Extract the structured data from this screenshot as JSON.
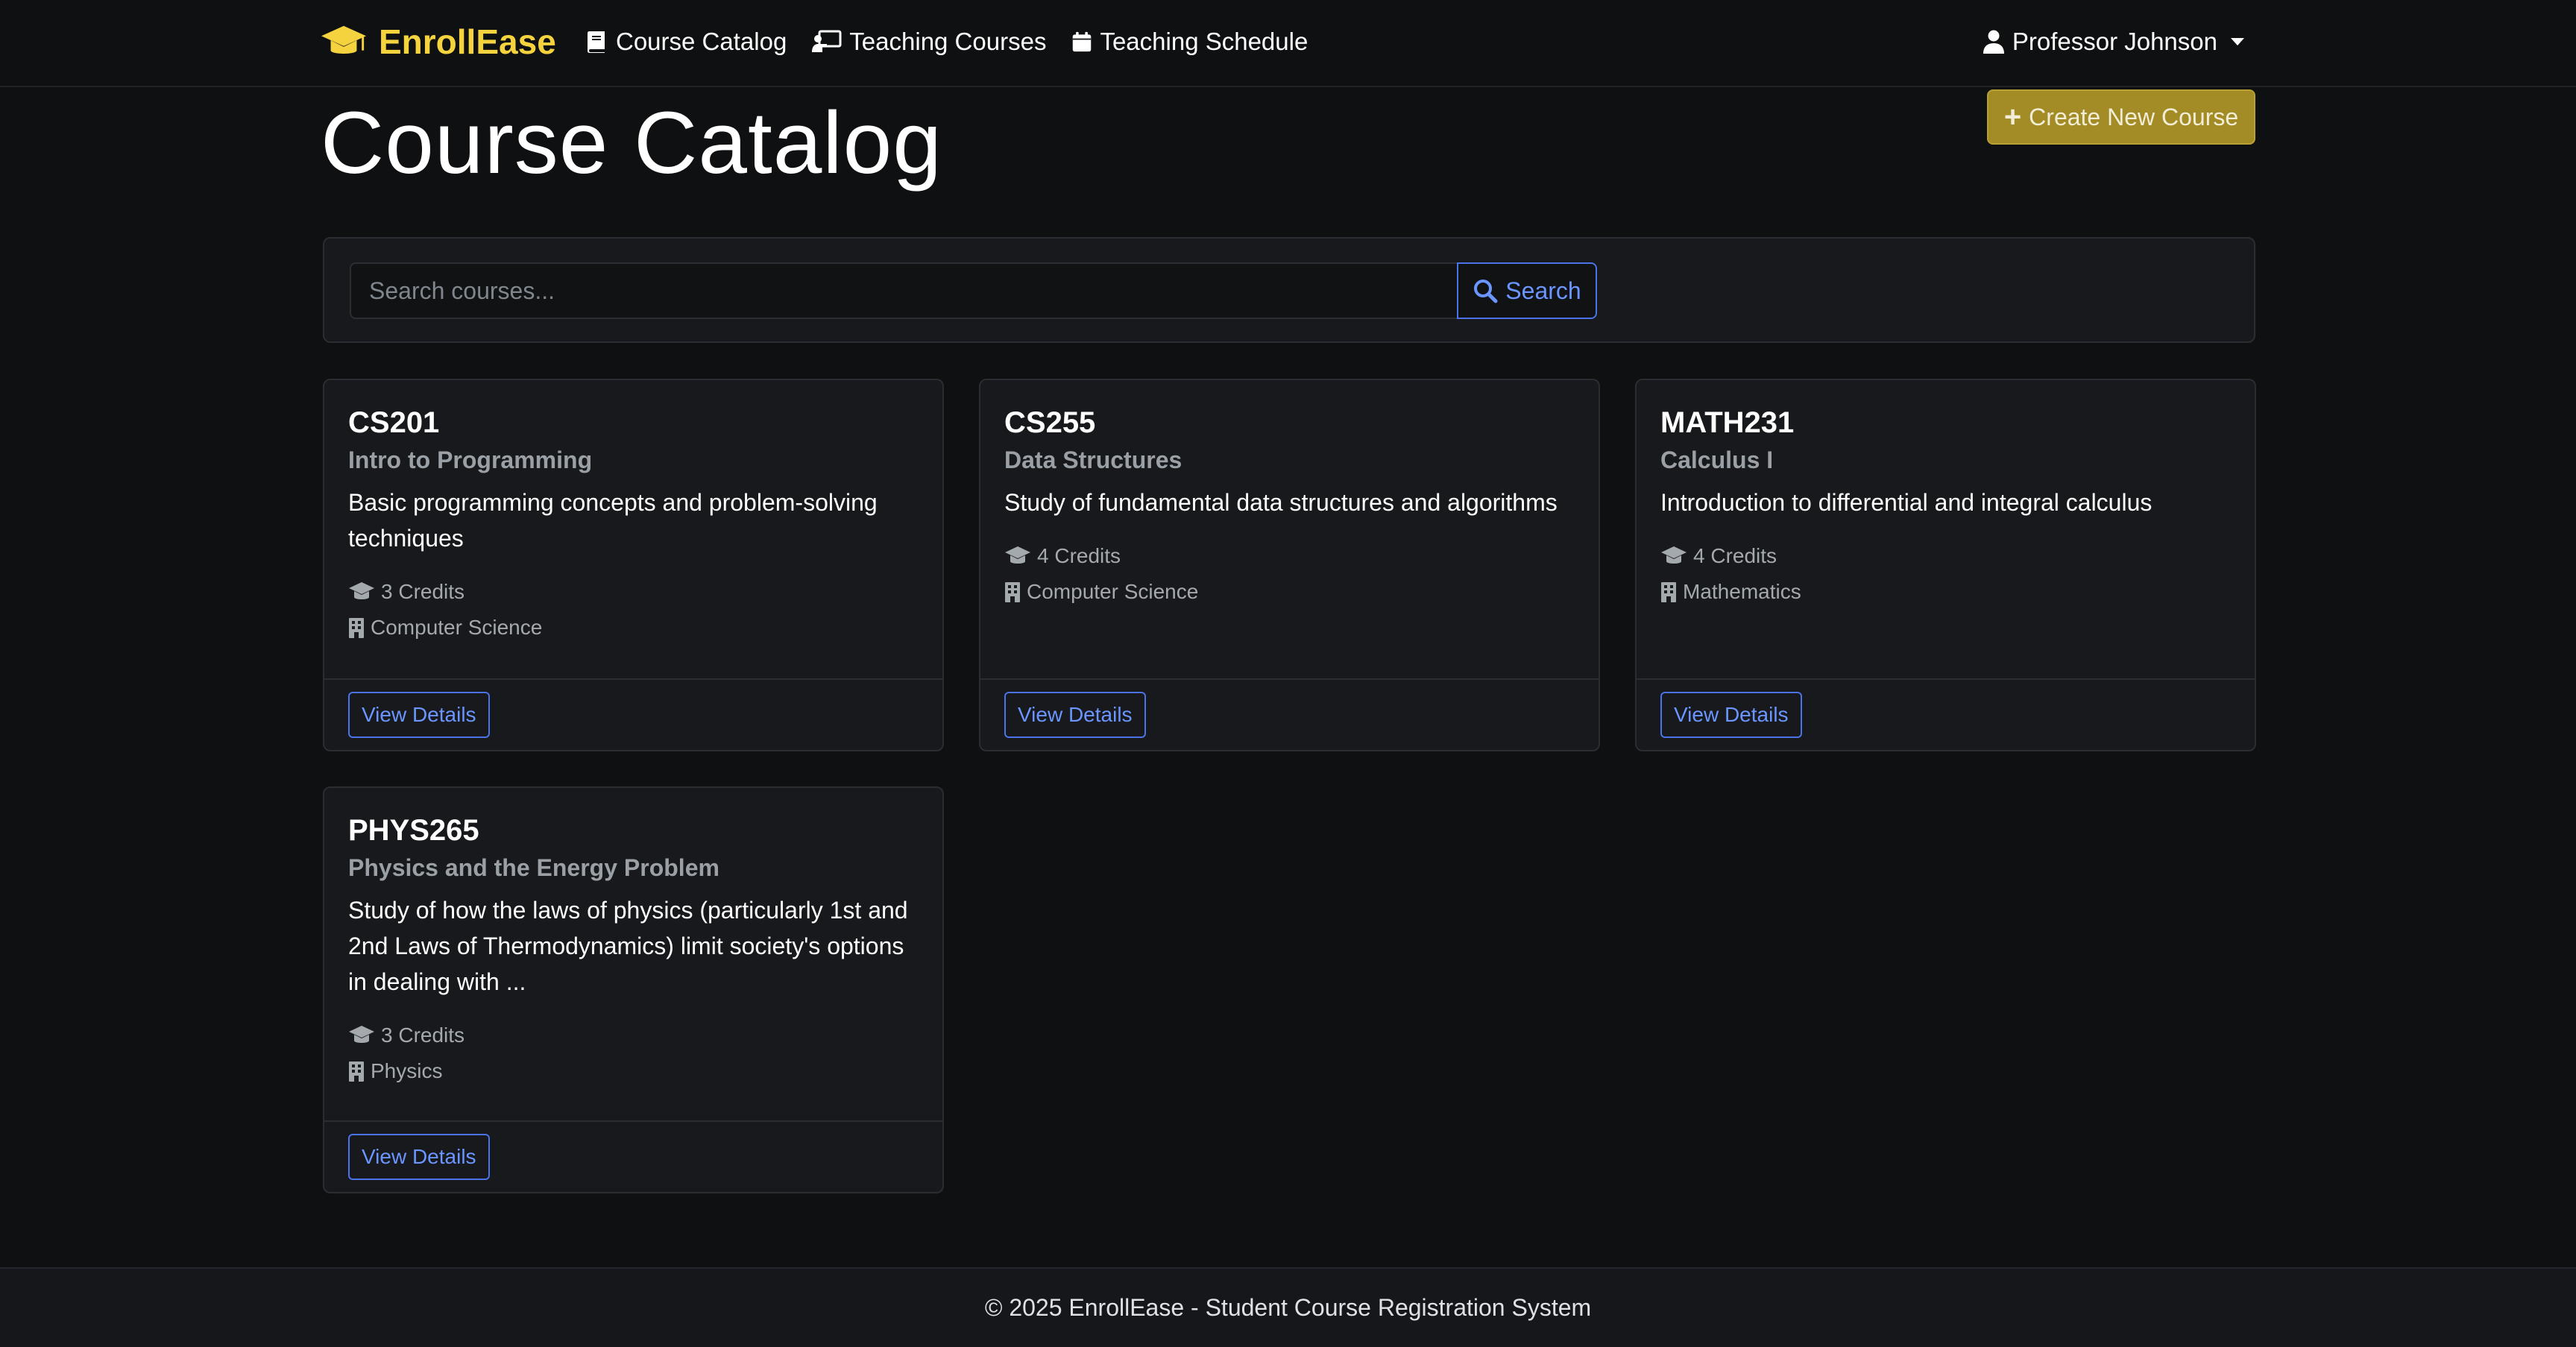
{
  "nav": {
    "brand": "EnrollEase",
    "links": [
      {
        "label": "Course Catalog"
      },
      {
        "label": "Teaching Courses"
      },
      {
        "label": "Teaching Schedule"
      }
    ],
    "user": "Professor Johnson"
  },
  "page": {
    "title": "Course Catalog",
    "create_button": "Create New Course"
  },
  "search": {
    "placeholder": "Search courses...",
    "value": "",
    "button": "Search"
  },
  "courses": [
    {
      "code": "CS201",
      "title": "Intro to Programming",
      "description": "Basic programming concepts and problem-solving techniques",
      "credits": "3 Credits",
      "department": "Computer Science",
      "button": "View Details"
    },
    {
      "code": "CS255",
      "title": "Data Structures",
      "description": "Study of fundamental data structures and algorithms",
      "credits": "4 Credits",
      "department": "Computer Science",
      "button": "View Details"
    },
    {
      "code": "MATH231",
      "title": "Calculus I",
      "description": "Introduction to differential and integral calculus",
      "credits": "4 Credits",
      "department": "Mathematics",
      "button": "View Details"
    },
    {
      "code": "PHYS265",
      "title": "Physics and the Energy Problem",
      "description": "Study of how the laws of physics (particularly 1st and 2nd Laws of Thermodynamics) limit society's options in dealing with ...",
      "credits": "3 Credits",
      "department": "Physics",
      "button": "View Details"
    }
  ],
  "footer": {
    "text": "© 2025 EnrollEase - Student Course Registration System"
  },
  "colors": {
    "background": "#0e1012",
    "brand": "#f5d33e",
    "primary_outline": "#4a73e8",
    "create_button": "#a38c26"
  },
  "icons": {
    "brand": "graduation-cap-icon",
    "course_catalog": "book-icon",
    "teaching_courses": "chalkboard-teacher-icon",
    "teaching_schedule": "calendar-icon",
    "user": "user-icon",
    "search": "search-icon",
    "credits": "graduation-cap-icon",
    "department": "building-icon"
  }
}
